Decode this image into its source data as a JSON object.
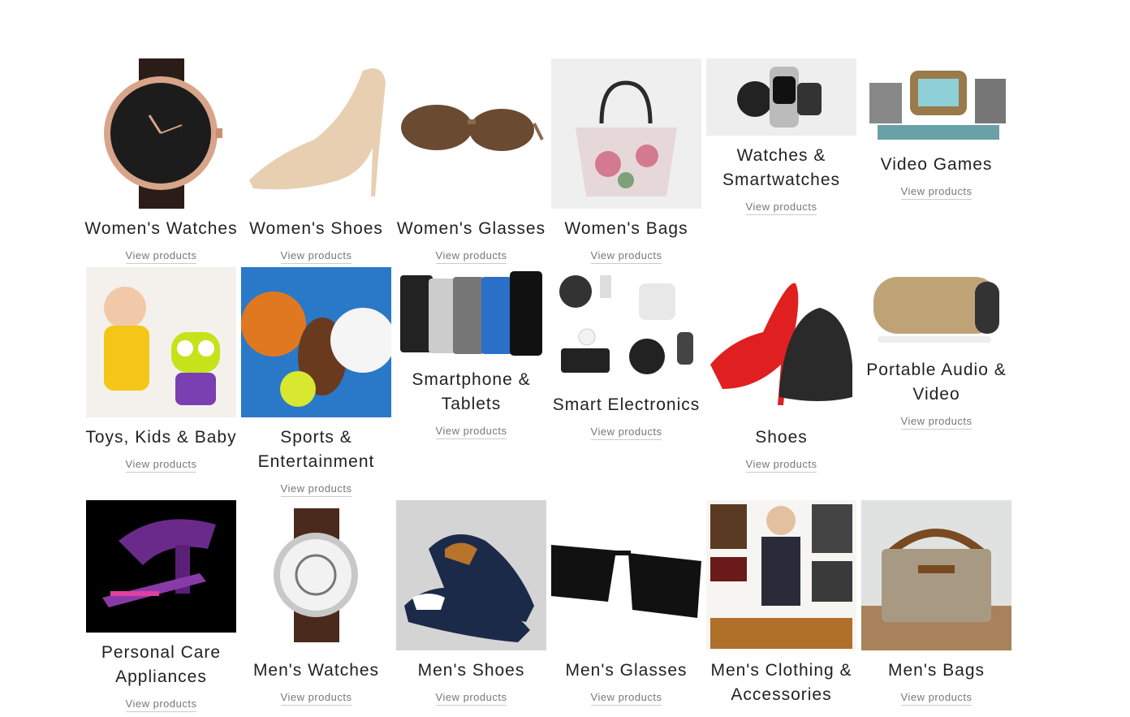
{
  "view_label": "View products",
  "categories": [
    {
      "title": "Women's Watches"
    },
    {
      "title": "Women's Shoes"
    },
    {
      "title": "Women's Glasses"
    },
    {
      "title": "Women's Bags"
    },
    {
      "title": "Watches & Smartwatches"
    },
    {
      "title": "Video Games"
    },
    {
      "title": "Toys, Kids & Baby"
    },
    {
      "title": "Sports & Entertainment"
    },
    {
      "title": "Smartphone & Tablets"
    },
    {
      "title": "Smart Electronics"
    },
    {
      "title": "Shoes"
    },
    {
      "title": "Portable Audio & Video"
    },
    {
      "title": "Personal Care Appliances"
    },
    {
      "title": "Men's Watches"
    },
    {
      "title": "Men's Shoes"
    },
    {
      "title": "Men's Glasses"
    },
    {
      "title": "Men's Clothing & Accessories"
    },
    {
      "title": "Men's Bags"
    }
  ]
}
